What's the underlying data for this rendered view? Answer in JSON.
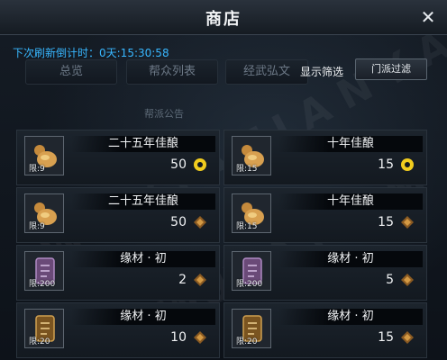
{
  "title": "商店",
  "refresh_label": "下次刷新倒计时：0天:15:30:58",
  "tabs": [
    {
      "label": "总览"
    },
    {
      "label": "帮众列表"
    },
    {
      "label": "经武弘文"
    }
  ],
  "filter": {
    "label": "显示筛选",
    "button": "门派过滤"
  },
  "notice": "帮派公告",
  "items": [
    {
      "name": "二十五年佳酿",
      "limit": "限:9",
      "price": "50",
      "currency": "gold-coin-icon",
      "icon": "gourd-icon"
    },
    {
      "name": "十年佳酿",
      "limit": "限:15",
      "price": "15",
      "currency": "gold-coin-icon",
      "icon": "gourd-icon"
    },
    {
      "name": "二十五年佳酿",
      "limit": "限:9",
      "price": "50",
      "currency": "guild-emblem-icon",
      "icon": "gourd-icon"
    },
    {
      "name": "十年佳酿",
      "limit": "限:15",
      "price": "15",
      "currency": "guild-emblem-icon",
      "icon": "gourd-icon"
    },
    {
      "name": "缘材 · 初",
      "limit": "限:200",
      "price": "2",
      "currency": "guild-emblem-icon",
      "icon": "material-tablet-icon"
    },
    {
      "name": "缘材 · 初",
      "limit": "限:200",
      "price": "5",
      "currency": "guild-emblem-icon",
      "icon": "material-tablet-icon"
    },
    {
      "name": "缘材 · 初",
      "limit": "限:20",
      "price": "10",
      "currency": "guild-emblem-icon",
      "icon": "material-tablet-icon"
    },
    {
      "name": "缘材 · 初",
      "limit": "限:20",
      "price": "15",
      "currency": "guild-emblem-icon",
      "icon": "material-tablet-icon"
    }
  ]
}
